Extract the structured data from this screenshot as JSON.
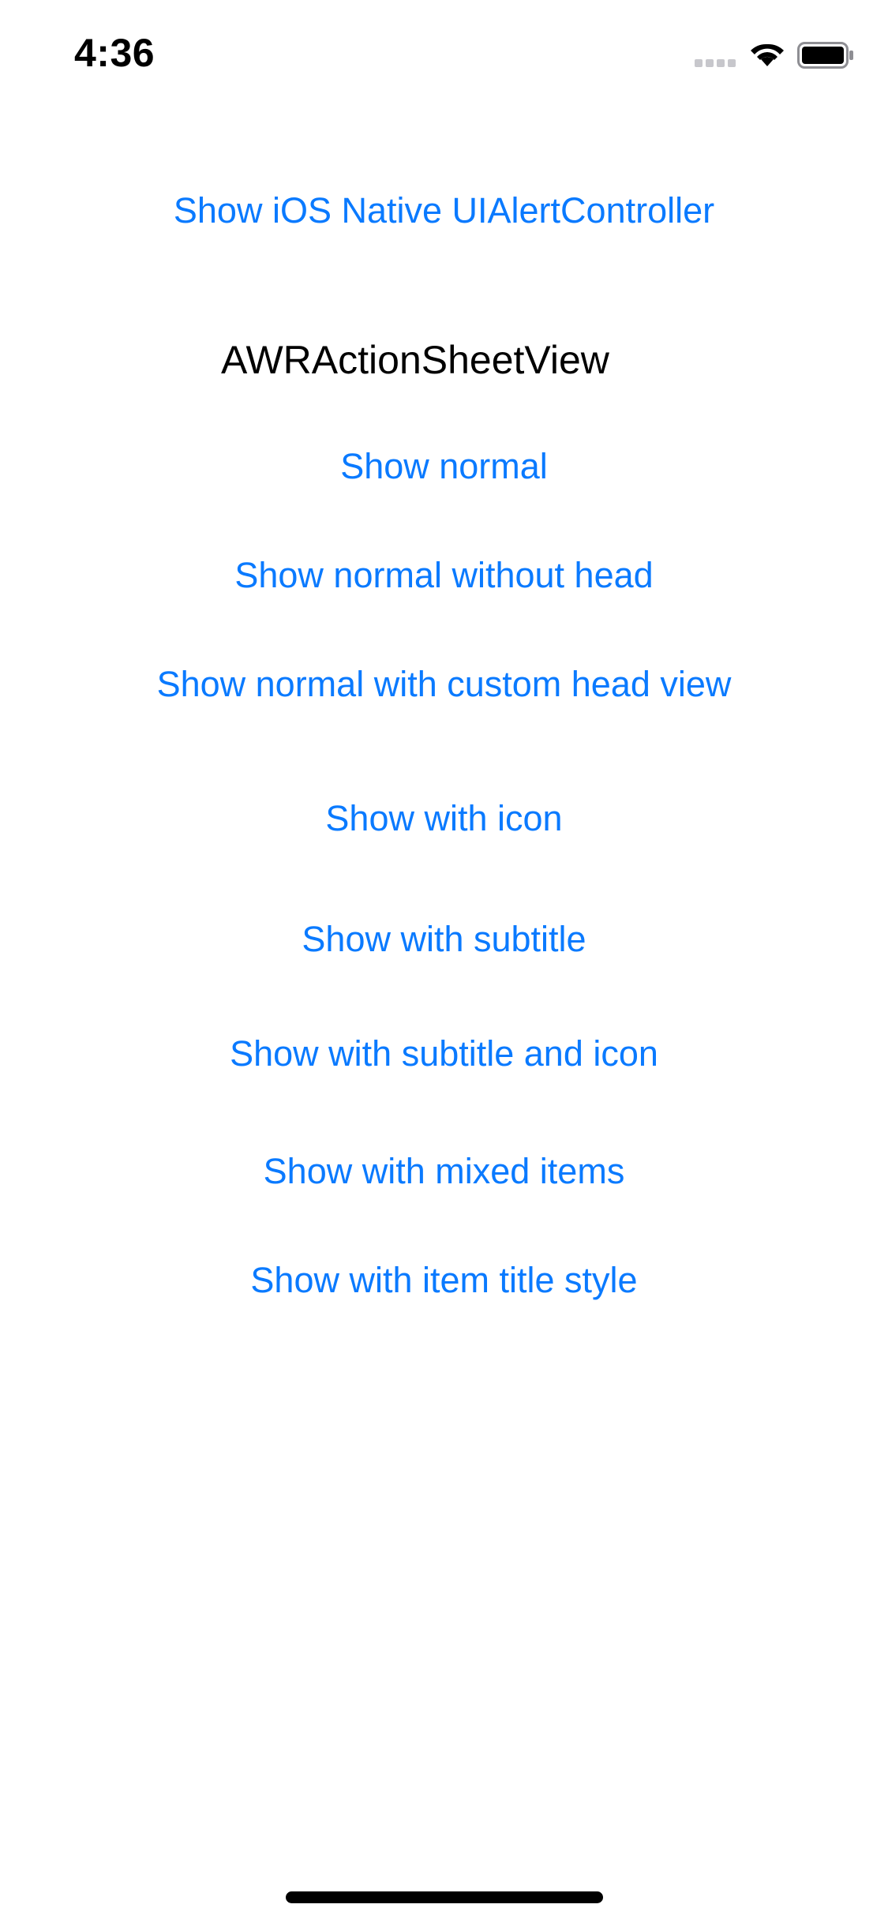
{
  "status_bar": {
    "time": "4:36",
    "icons": [
      "cellular-signal-icon",
      "wifi-icon",
      "battery-icon"
    ]
  },
  "colors": {
    "link": "#0a7aff",
    "text": "#000000",
    "background": "#ffffff"
  },
  "native_button_label": "Show iOS Native UIAlertController",
  "section_title": "AWRActionSheetView",
  "buttons": [
    {
      "label": "Show normal"
    },
    {
      "label": "Show normal without head"
    },
    {
      "label": "Show normal with custom head view"
    },
    {
      "label": "Show with icon"
    },
    {
      "label": "Show with subtitle"
    },
    {
      "label": "Show with subtitle and icon"
    },
    {
      "label": "Show with mixed items"
    },
    {
      "label": "Show with item title style"
    }
  ]
}
